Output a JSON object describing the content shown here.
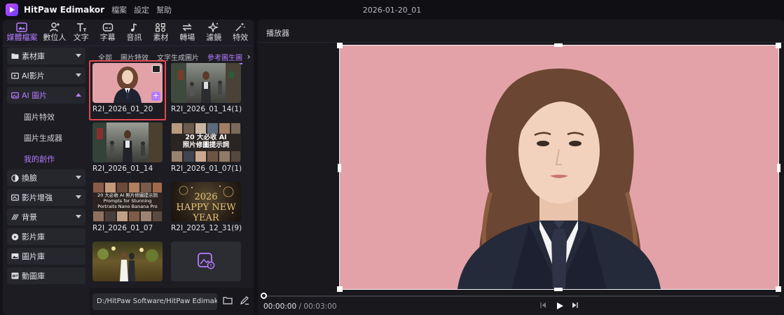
{
  "app": {
    "name": "HitPaw Edimakor",
    "menu": [
      "檔案",
      "設定",
      "幫助"
    ],
    "document_title": "2026-01-20_01"
  },
  "toolbar": [
    {
      "label": "媒體檔案",
      "icon": "media-icon",
      "active": true
    },
    {
      "label": "數位人",
      "icon": "avatar-add-icon",
      "active": false
    },
    {
      "label": "文字",
      "icon": "text-icon",
      "active": false
    },
    {
      "label": "字幕",
      "icon": "subtitle-icon",
      "active": false
    },
    {
      "label": "音訊",
      "icon": "music-note-icon",
      "active": false
    },
    {
      "label": "素材",
      "icon": "grid-icon",
      "active": false
    },
    {
      "label": "轉場",
      "icon": "transition-icon",
      "active": false
    },
    {
      "label": "濾鏡",
      "icon": "sparkle-icon",
      "active": false
    },
    {
      "label": "特效",
      "icon": "effects-icon",
      "active": false
    }
  ],
  "sidebar": {
    "categories": [
      {
        "label": "素材庫",
        "icon": "folder-icon"
      },
      {
        "label": "AI影片",
        "icon": "ai-video-icon"
      },
      {
        "label": "AI 圖片",
        "icon": "ai-image-icon",
        "active": true
      }
    ],
    "sub_items": [
      {
        "label": "圖片特效"
      },
      {
        "label": "圖片生成器"
      },
      {
        "label": "我的創作",
        "active": true
      }
    ],
    "categories_after": [
      {
        "label": "換臉",
        "icon": "face-swap-icon",
        "caret": true
      },
      {
        "label": "影片增強",
        "icon": "enhance-icon",
        "caret": true
      },
      {
        "label": "背景",
        "icon": "background-icon",
        "caret": true
      },
      {
        "label": "影片庫",
        "icon": "video-library-icon",
        "caret": false
      },
      {
        "label": "圖片庫",
        "icon": "image-library-icon",
        "caret": false
      },
      {
        "label": "動圖庫",
        "icon": "gif-icon",
        "caret": false
      }
    ]
  },
  "tabs": [
    {
      "label": "全部"
    },
    {
      "label": "圖片特效"
    },
    {
      "label": "文字生成圖片"
    },
    {
      "label": "參考圖生圖",
      "active": true
    }
  ],
  "grid": {
    "items": [
      {
        "caption": "R2I_2026_01_20",
        "selected": true
      },
      {
        "caption": "R2I_2026_01_14(1)"
      },
      {
        "caption": "R2I_2026_01_14"
      },
      {
        "caption": "R2I_2026_01_07(1)",
        "overlay": "20 大必收 AI\n照片修圖提示詞"
      },
      {
        "caption": "R2I_2026_01_07",
        "overlay": "20 大必收 AI 照片修圖提示詞\nPrompts for Stunning\nPortraits Nano Banana Pro"
      },
      {
        "caption": "R2I_2025_12_31(9)",
        "overlay": "2026\nHAPPY NEW YEAR"
      },
      {
        "caption": ""
      },
      {
        "caption": "",
        "placeholder_icon": "add-image-icon"
      }
    ]
  },
  "bottom": {
    "path": "D:/HitPaw Software/HitPaw Edimak..."
  },
  "player": {
    "title": "播放器",
    "current_time": "00:00:00",
    "separator": "/",
    "total_time": "00:03:00",
    "progress": 0
  },
  "colors": {
    "accent": "#b47cff",
    "selection": "#e0484e",
    "video_background": "#e3a2a8"
  }
}
